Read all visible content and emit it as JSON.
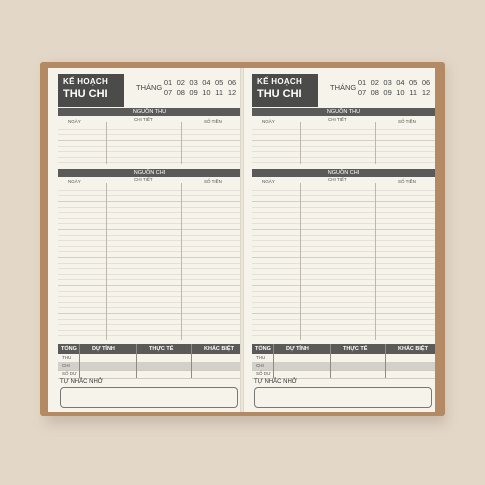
{
  "planner": {
    "title_line1": "KẾ HOẠCH",
    "title_line2": "THU CHI",
    "month_label": "THÁNG",
    "months_row1": [
      "01",
      "02",
      "03",
      "04",
      "05",
      "06"
    ],
    "months_row2": [
      "07",
      "08",
      "09",
      "10",
      "11",
      "12"
    ],
    "income_section": "NGUỒN THU",
    "expense_section": "NGUỒN CHI",
    "col_date": "NGÀY",
    "col_detail": "CHI TIẾT",
    "col_amount": "SỐ TIỀN",
    "summary": {
      "col_total": "TỔNG",
      "col_estimate": "DỰ TÍNH",
      "col_actual": "THỰC TẾ",
      "col_diff": "KHÁC BIỆT",
      "row_income": "THU",
      "row_expense": "CHI",
      "row_balance": "SỐ DƯ"
    },
    "note_label": "TỰ NHẮC NHỞ"
  },
  "colors": {
    "background": "#e3d7c8",
    "cover": "#b38a64",
    "paper": "#f6f3ea",
    "header": "#4b4b49"
  }
}
